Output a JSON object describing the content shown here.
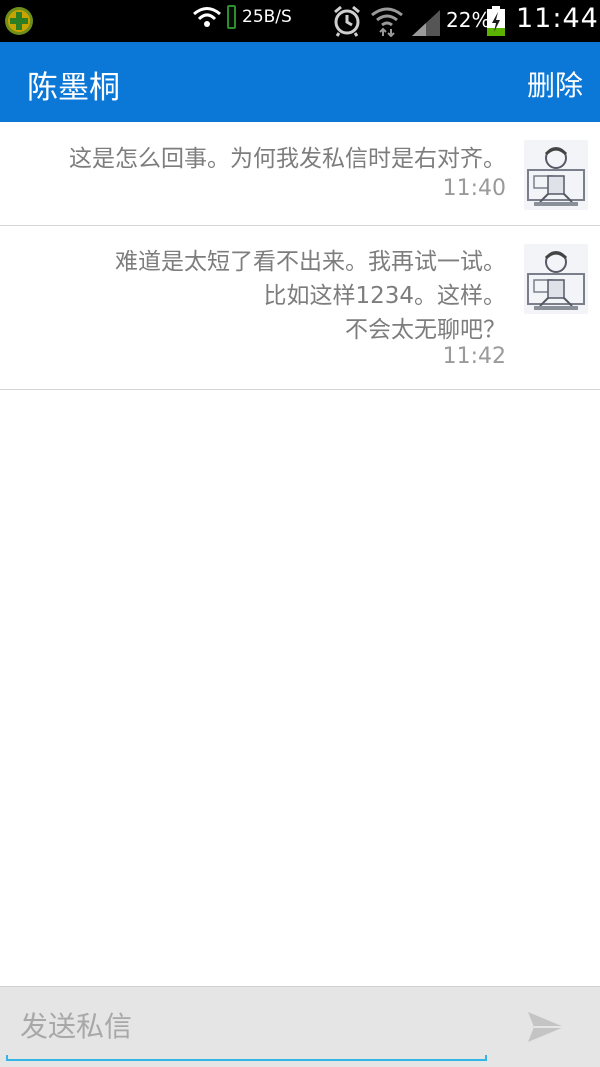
{
  "status_bar": {
    "net_speed": "25B/S",
    "battery_percent": "22%",
    "time": "11:44",
    "icons": [
      "app-plus-icon",
      "wifi-icon",
      "alarm-icon",
      "wifi-arrows-icon",
      "signal-icon",
      "battery-charging-icon"
    ]
  },
  "header": {
    "title": "陈墨桐",
    "delete_label": "删除",
    "background_color": "#0b78d8"
  },
  "messages": [
    {
      "text": "这是怎么回事。为何我发私信时是右对齐。",
      "time": "11:40"
    },
    {
      "text": "难道是太短了看不出来。我再试一试。\n比如这样1234。这样。\n不会太无聊吧？",
      "time": "11:42"
    }
  ],
  "compose": {
    "placeholder": "发送私信",
    "send_icon": "send-icon"
  }
}
